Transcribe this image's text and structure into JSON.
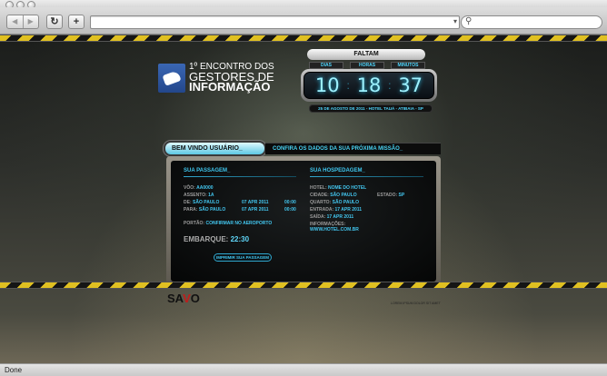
{
  "browser": {
    "nav_back": "◀",
    "nav_forward": "▶",
    "reload_icon": "reload-icon",
    "add_icon": "add-tab-icon",
    "url_value": "",
    "search_value": "",
    "status": "Done"
  },
  "header": {
    "logo_line1": "1º ENCONTRO DOS",
    "logo_line2": "GESTORES DE",
    "logo_line3": "INFORMAÇÃO"
  },
  "countdown": {
    "label": "FALTAM",
    "units": [
      "DIAS",
      "HORAS",
      "MINUTOS"
    ],
    "days": "10",
    "hours": "18",
    "minutes": "37",
    "event_info": "25 DE AGOSTO DE 2011 - HOTEL TAUÁ - ATIBAIA - SP"
  },
  "tabs": {
    "active": "BEM VINDO USUÁRIO_",
    "subtitle": "CONFIRA OS DADOS DA SUA PRÓXIMA MISSÃO_"
  },
  "passagem": {
    "title": "SUA PASSAGEM_",
    "voo_label": "VÔO:",
    "voo": "AA0000",
    "assento_label": "ASSENTO:",
    "assento": "1A",
    "de_label": "DE:",
    "de_city": "SÃO PAULO",
    "de_date": "07 APR 2011",
    "de_time": "00:00",
    "para_label": "PARA:",
    "para_city": "SÃO PAULO",
    "para_date": "07 APR 2011",
    "para_time": "00:00",
    "portao_label": "PORTÃO:",
    "portao": "CONFIRMAR NO AEROPORTO",
    "embarque_label": "EMBARQUE:",
    "embarque": "22:30",
    "print_button": "IMPRIMIR SUA PASSAGEM"
  },
  "hospedagem": {
    "title": "SUA HOSPEDAGEM_",
    "hotel_label": "HOTEL:",
    "hotel": "NOME DO HOTEL",
    "cidade_label": "CIDADE:",
    "cidade": "SÃO PAULO",
    "estado_label": "ESTADO:",
    "estado": "SP",
    "quarto_label": "QUARTO:",
    "quarto": "SÃO PAULO",
    "entrada_label": "ENTRADA:",
    "entrada": "17 APR 2011",
    "saida_label": "SAÍDA:",
    "saida": "17 APR 2011",
    "info_label": "INFORMAÇÕES:",
    "info": "WWW.HOTEL.COM.BR"
  },
  "footer": {
    "brand_start": "SA",
    "brand_mid": "V",
    "brand_end": "O",
    "credits": "LOREM IPSUM DOLOR SIT AMET"
  },
  "colors": {
    "accent": "#43c7f0",
    "hazard_yellow": "#e0c021",
    "brand_red": "#c21b1b"
  }
}
